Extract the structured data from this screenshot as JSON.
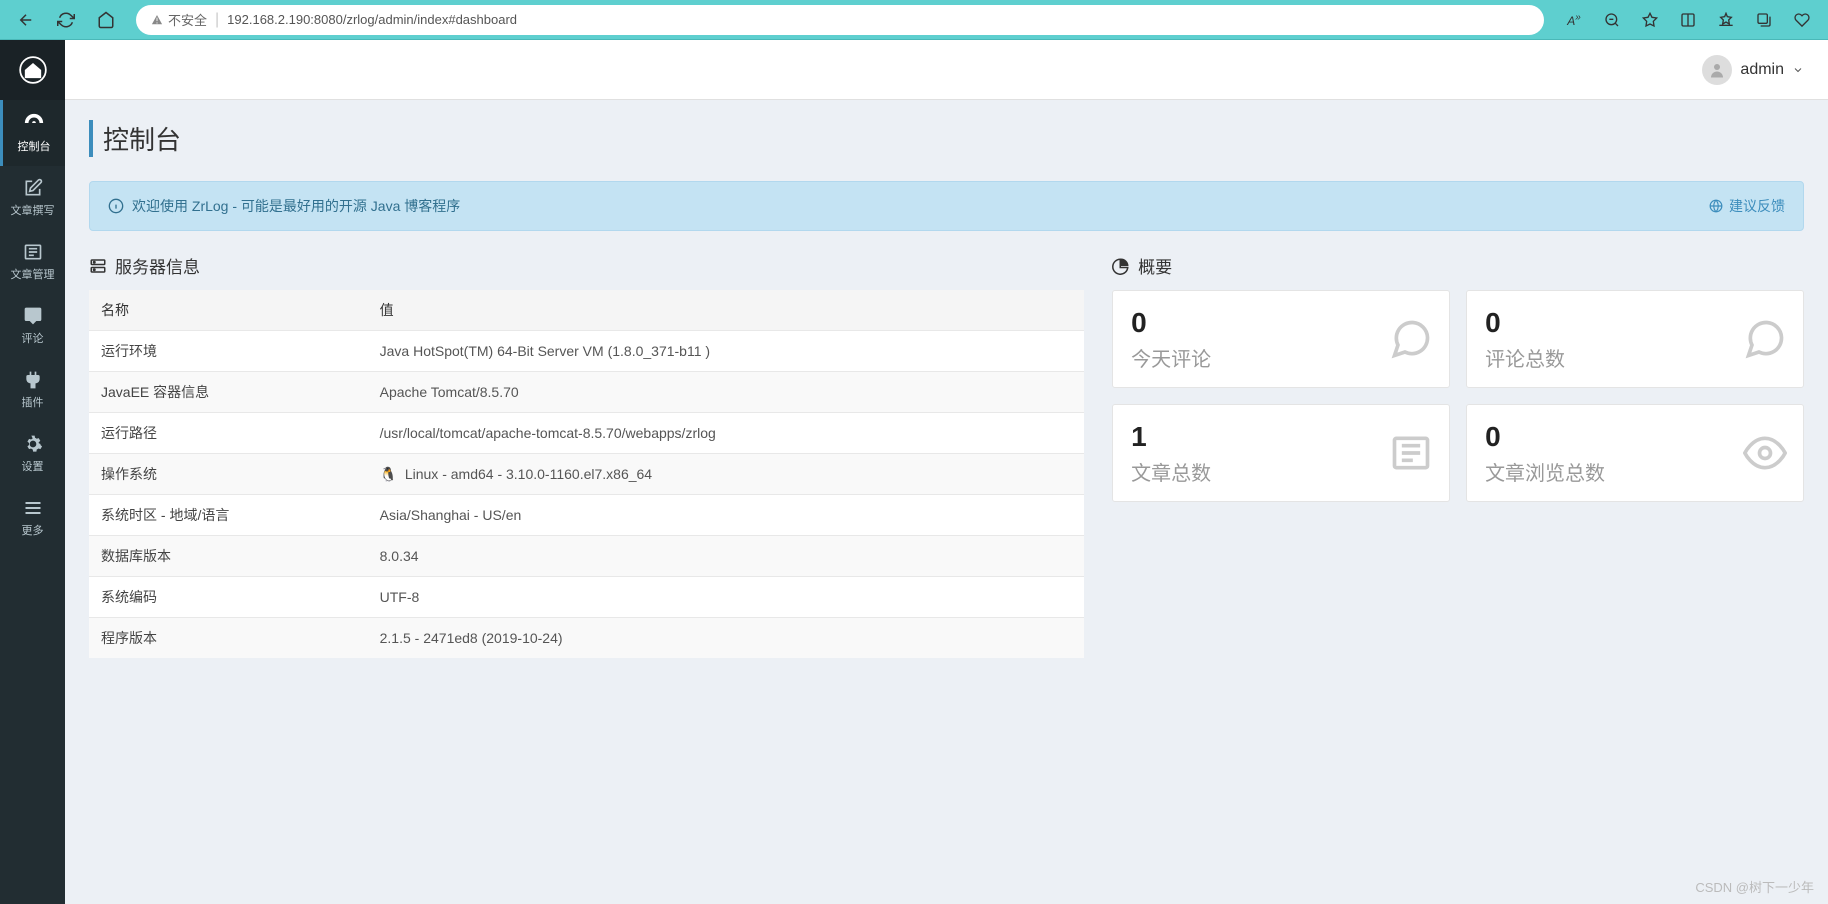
{
  "browser": {
    "url": "192.168.2.190:8080/zrlog/admin/index#dashboard",
    "insecure_label": "不安全"
  },
  "topbar": {
    "username": "admin"
  },
  "sidebar": {
    "items": [
      {
        "label": "控制台",
        "icon": "dashboard"
      },
      {
        "label": "文章撰写",
        "icon": "edit"
      },
      {
        "label": "文章管理",
        "icon": "news"
      },
      {
        "label": "评论",
        "icon": "chat"
      },
      {
        "label": "插件",
        "icon": "plug"
      },
      {
        "label": "设置",
        "icon": "gear"
      },
      {
        "label": "更多",
        "icon": "bars"
      }
    ]
  },
  "page": {
    "title": "控制台"
  },
  "welcome": {
    "message": "欢迎使用 ZrLog - 可能是最好用的开源 Java 博客程序",
    "feedback": "建议反馈"
  },
  "serverInfo": {
    "title": "服务器信息",
    "headers": {
      "name": "名称",
      "value": "值"
    },
    "rows": [
      {
        "name": "运行环境",
        "value": "Java HotSpot(TM) 64-Bit Server VM (1.8.0_371-b11 )"
      },
      {
        "name": "JavaEE 容器信息",
        "value": "Apache Tomcat/8.5.70"
      },
      {
        "name": "运行路径",
        "value": "/usr/local/tomcat/apache-tomcat-8.5.70/webapps/zrlog"
      },
      {
        "name": "操作系统",
        "value": "Linux - amd64 - 3.10.0-1160.el7.x86_64",
        "os_icon": true
      },
      {
        "name": "系统时区 - 地域/语言",
        "value": "Asia/Shanghai - US/en"
      },
      {
        "name": "数据库版本",
        "value": "8.0.34"
      },
      {
        "name": "系统编码",
        "value": "UTF-8"
      },
      {
        "name": "程序版本",
        "value": "2.1.5 - 2471ed8 (2019-10-24)"
      }
    ]
  },
  "overview": {
    "title": "概要",
    "stats": [
      {
        "value": "0",
        "label": "今天评论",
        "icon": "chat"
      },
      {
        "value": "0",
        "label": "评论总数",
        "icon": "chat"
      },
      {
        "value": "1",
        "label": "文章总数",
        "icon": "news"
      },
      {
        "value": "0",
        "label": "文章浏览总数",
        "icon": "eye"
      }
    ]
  },
  "watermark": "CSDN @树下一少年"
}
